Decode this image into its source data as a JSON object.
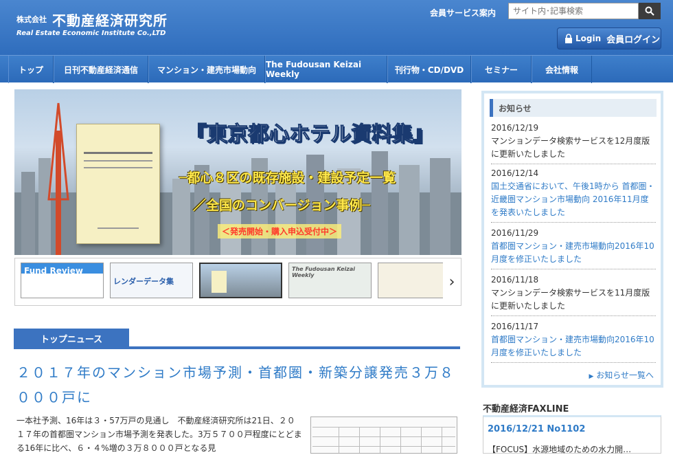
{
  "header": {
    "logo_small": "株式会社",
    "logo_main": "不動産経済研究所",
    "logo_en": "Real Estate Economic Institute Co.,LTD",
    "member_service": "会員サービス案内",
    "search_placeholder": "サイト内･記事検索",
    "login_label": "Login",
    "login_jp": "会員ログイン"
  },
  "nav": {
    "items": [
      {
        "label": "トップ"
      },
      {
        "label": "日刊不動産経済通信"
      },
      {
        "label": "マンション・建売市場動向"
      },
      {
        "label": "The Fudousan Keizai Weekly"
      },
      {
        "label": "刊行物・CD/DVD"
      },
      {
        "label": "セミナー"
      },
      {
        "label": "会社情報"
      }
    ]
  },
  "banner": {
    "title": "『東京都心ホテル資料集』",
    "sub1": "─都心８区の既存施設・建設予定一覧",
    "sub2": "／全国のコンバージョン事例─",
    "tag": "＜発売開始・購入申込受付中＞"
  },
  "thumbs": [
    {
      "label": "Fund Review"
    },
    {
      "label": "レンダーデータ集"
    },
    {
      "label": ""
    },
    {
      "label": "The Fudousan Keizai Weekly"
    },
    {
      "label": ""
    }
  ],
  "news": {
    "tab_label": "トップニュース",
    "headline": "２０１７年のマンション市場予測・首都圏・新築分譲発売３万８０００戸に",
    "body": "一本社予測、16年は３・57万戸の見通し　不動産経済研究所は21日、２０１７年の首都圏マンション市場予測を発表した。3万５７００戸程度にとどまる16年に比べ、６・４%増の３万８０００戸となる見"
  },
  "notice": {
    "heading": "お知らせ",
    "items": [
      {
        "date": "2016/12/19",
        "text": "マンションデータ検索サービスを12月度版に更新いたしました",
        "link": false
      },
      {
        "date": "2016/12/14",
        "text": "国土交通省において、午後1時から 首都圏・近畿圏マンション市場動向 2016年11月度を発表いたしました",
        "link": true
      },
      {
        "date": "2016/11/29",
        "text": "首都圏マンション・建売市場動向2016年10月度を修正いたしました",
        "link": true
      },
      {
        "date": "2016/11/18",
        "text": "マンションデータ検索サービスを11月度版に更新いたしました",
        "link": false
      },
      {
        "date": "2016/11/17",
        "text": "首都圏マンション・建売市場動向2016年10月度を修正いたしました",
        "link": true
      }
    ],
    "more": "お知らせ一覧へ"
  },
  "fax": {
    "title": "不動産経済FAXLINE",
    "date": "2016/12/21 No1102",
    "item": "【FOCUS】水源地域のための水力開…"
  }
}
